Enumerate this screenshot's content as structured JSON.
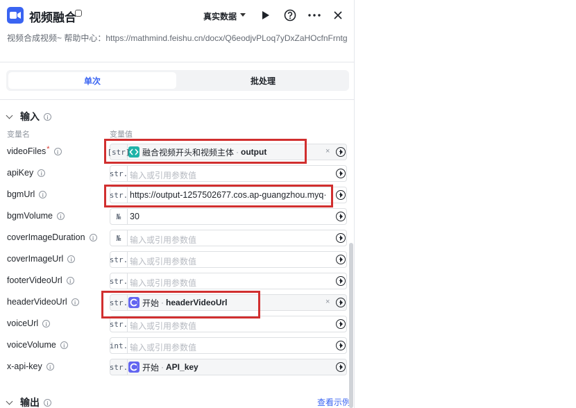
{
  "header": {
    "title": "视频融合",
    "data_mode": "真实数据",
    "icons": [
      "video-camera-icon",
      "badge-icon",
      "play-icon",
      "help-icon",
      "more-icon",
      "close-icon"
    ]
  },
  "description": "视频合成视频~ 帮助中心：https://mathmind.feishu.cn/docx/Q6eodjvPLoq7yDxZaHOcfnFrntg",
  "tabs": {
    "single": "单次",
    "batch": "批处理",
    "active": "single"
  },
  "input_section": {
    "title": "输入",
    "col_name": "变量名",
    "col_value": "变量值",
    "rows": [
      {
        "name": "videoFiles",
        "required": "*",
        "type": "[str]",
        "kind": "ref",
        "node": "融合视频开头和视频主体",
        "sep": "·",
        "var": "output",
        "clear": "×"
      },
      {
        "name": "apiKey",
        "type": "str.",
        "kind": "empty",
        "placeholder": "输入或引用参数值"
      },
      {
        "name": "bgmUrl",
        "type": "str.",
        "kind": "text",
        "value": "https://output-1257502677.cos.ap-guangzhou.myq·"
      },
      {
        "name": "bgmVolume",
        "type": "№",
        "kind": "text",
        "value": "30"
      },
      {
        "name": "coverImageDuration",
        "type": "№",
        "kind": "empty",
        "placeholder": "输入或引用参数值"
      },
      {
        "name": "coverImageUrl",
        "type": "str.",
        "kind": "empty",
        "placeholder": "输入或引用参数值"
      },
      {
        "name": "footerVideoUrl",
        "type": "str.",
        "kind": "empty",
        "placeholder": "输入或引用参数值"
      },
      {
        "name": "headerVideoUrl",
        "type": "str.",
        "kind": "ref",
        "node": "开始",
        "sep": "·",
        "var": "headerVideoUrl",
        "clear": "×"
      },
      {
        "name": "voiceUrl",
        "type": "str.",
        "kind": "empty",
        "placeholder": "输入或引用参数值"
      },
      {
        "name": "voiceVolume",
        "type": "int.",
        "kind": "empty",
        "placeholder": "输入或引用参数值"
      },
      {
        "name": "x-api-key",
        "type": "str.",
        "kind": "ref",
        "node": "开始",
        "sep": "·",
        "var": "API_key"
      }
    ]
  },
  "output_section": {
    "title": "输出",
    "view_example": "查看示例"
  },
  "colors": {
    "accent": "#3a64f2",
    "highlight": "#d12f2f",
    "teal_node": "#1fb3a8",
    "purple_node": "#6265f0"
  }
}
